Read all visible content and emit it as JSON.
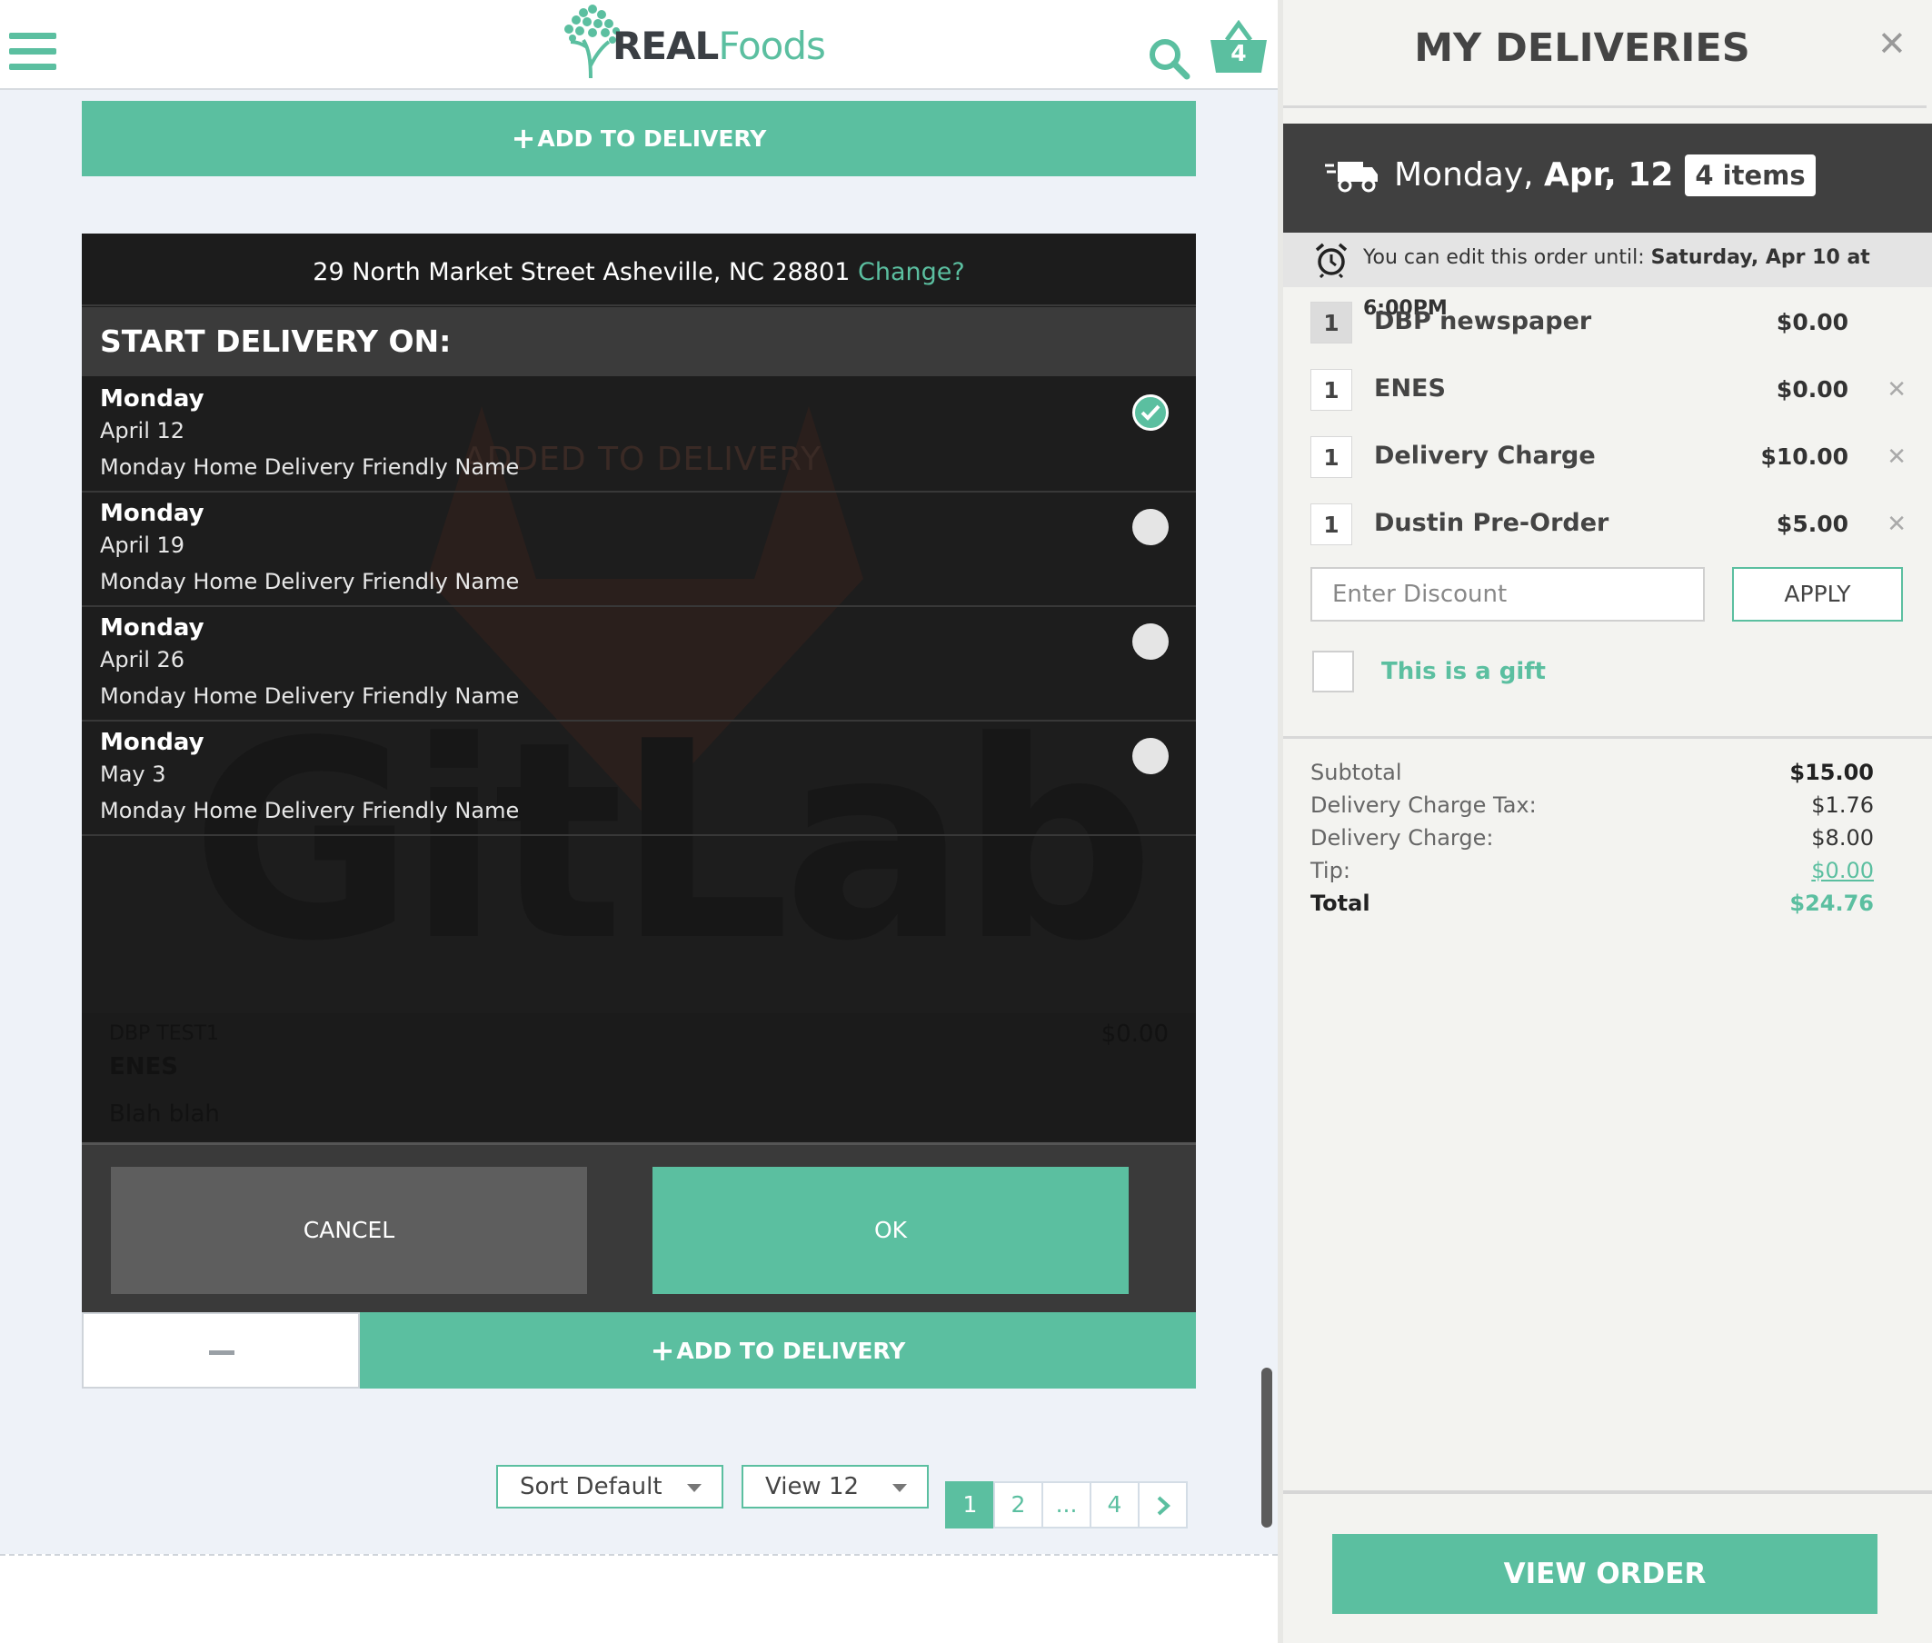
{
  "header": {
    "logo_real": "REAL",
    "logo_foods": "Foods",
    "cart_count": "4"
  },
  "product": {
    "add_to_delivery": "ADD TO DELIVERY"
  },
  "modal": {
    "address": "29 North Market Street Asheville, NC 28801",
    "change_link": "Change?",
    "heading": "START DELIVERY ON:",
    "watermark_added": "ADDED TO DELIVERY",
    "watermark_gitlab": "GitLab",
    "dates": [
      {
        "day": "Monday",
        "date": "April 12",
        "name": "Monday Home Delivery Friendly Name",
        "selected": true
      },
      {
        "day": "Monday",
        "date": "April 19",
        "name": "Monday Home Delivery Friendly Name",
        "selected": false
      },
      {
        "day": "Monday",
        "date": "April 26",
        "name": "Monday Home Delivery Friendly Name",
        "selected": false
      },
      {
        "day": "Monday",
        "date": "May 3",
        "name": "Monday Home Delivery Friendly Name",
        "selected": false
      }
    ],
    "ghost": {
      "line1": "DBP TEST1",
      "price": "$0.00",
      "line2": "ENES",
      "line3": "Blah blah"
    },
    "cancel_label": "CANCEL",
    "ok_label": "OK"
  },
  "listing": {
    "sort_label": "Sort Default",
    "view_label": "View 12",
    "pages": [
      "1",
      "2",
      "...",
      "4"
    ],
    "active_page": "1"
  },
  "panel": {
    "title": "MY DELIVERIES",
    "delivery_day": "Monday,",
    "delivery_date": "Apr, 12",
    "items_badge": "4 items",
    "edit_note": "You can edit this order until:",
    "edit_deadline": "Saturday, Apr 10 at 6:00PM",
    "items": [
      {
        "qty": "1",
        "name": "DBP newspaper",
        "price": "$0.00",
        "removable": false
      },
      {
        "qty": "1",
        "name": "ENES",
        "price": "$0.00",
        "removable": true
      },
      {
        "qty": "1",
        "name": "Delivery Charge",
        "price": "$10.00",
        "removable": true
      },
      {
        "qty": "1",
        "name": "Dustin Pre-Order",
        "price": "$5.00",
        "removable": true
      }
    ],
    "discount_placeholder": "Enter Discount",
    "apply_label": "APPLY",
    "gift_label": "This is a gift",
    "summary": {
      "subtotal_label": "Subtotal",
      "subtotal": "$15.00",
      "tax_label": "Delivery Charge Tax:",
      "tax": "$1.76",
      "charge_label": "Delivery Charge:",
      "charge": "$8.00",
      "tip_label": "Tip:",
      "tip": "$0.00",
      "total_label": "Total",
      "total": "$24.76"
    },
    "view_order_label": "VIEW ORDER"
  },
  "colors": {
    "accent": "#5bbfa0",
    "dark": "#404040"
  }
}
